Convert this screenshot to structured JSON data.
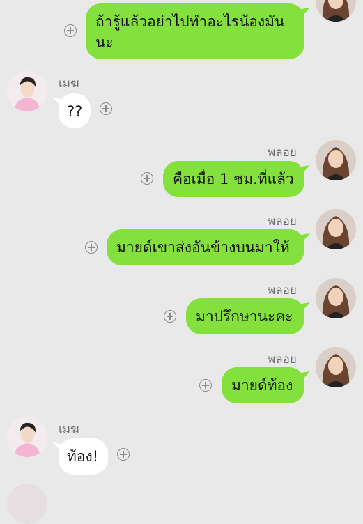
{
  "messages": [
    {
      "side": "out",
      "sender": "",
      "text": "ถ้ารู้แล้วอย่าไปทำอะไรน้องมัน นะ"
    },
    {
      "side": "in",
      "sender": "เมฆ",
      "text": "??"
    },
    {
      "side": "out",
      "sender": "พลอย",
      "text": "คือเมื่อ 1 ชม.ที่แล้ว"
    },
    {
      "side": "out",
      "sender": "พลอย",
      "text": "มายด์เขาส่งอันข้างบนมาให้"
    },
    {
      "side": "out",
      "sender": "พลอย",
      "text": "มาปรึกษานะคะ"
    },
    {
      "side": "out",
      "sender": "พลอย",
      "text": "มายด์ท้อง"
    },
    {
      "side": "in",
      "sender": "เมฆ",
      "text": "ท้อง!"
    }
  ],
  "m0": {
    "line1": "ถ้ารู้แล้วอย่าไปทำอะไรน้องมัน",
    "line2": "นะ"
  },
  "colors": {
    "background": "#e9e9e9",
    "outgoing_bubble": "#84e03d",
    "incoming_bubble": "#ffffff",
    "sender_name": "#6b6b6b"
  },
  "icons": {
    "add_reaction": "plus-circle-icon"
  }
}
